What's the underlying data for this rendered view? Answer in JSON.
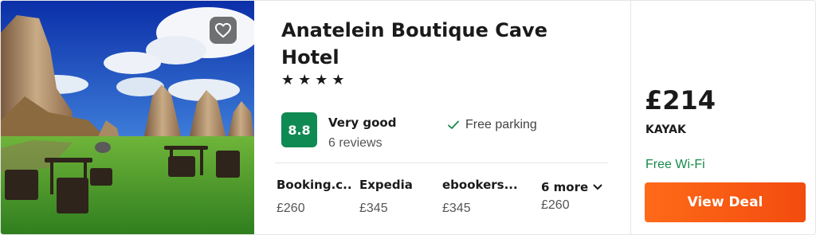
{
  "hotel": {
    "name_line1": "Anatelein Boutique Cave",
    "name_line2": "Hotel",
    "stars": "★★★★",
    "photo_icon": "hotel-photo",
    "favorite_icon": "heart-outline-icon"
  },
  "rating": {
    "score": "8.8",
    "label": "Very good",
    "reviews": "6 reviews",
    "color": "#0f8a52"
  },
  "amenity": {
    "icon": "check-icon",
    "label": "Free parking"
  },
  "providers": [
    {
      "name": "Booking.c...",
      "price": "£260"
    },
    {
      "name": "Expedia",
      "price": "£345"
    },
    {
      "name": "ebookers....",
      "price": "£345"
    }
  ],
  "more": {
    "label": "6 more",
    "price": "£260",
    "icon": "chevron-down-icon"
  },
  "deal": {
    "price": "£214",
    "provider": "KAYAK",
    "perk": "Free Wi-Fi",
    "perk_color": "#168a4a",
    "button_label": "View Deal",
    "button_color": "#ff6a18"
  }
}
